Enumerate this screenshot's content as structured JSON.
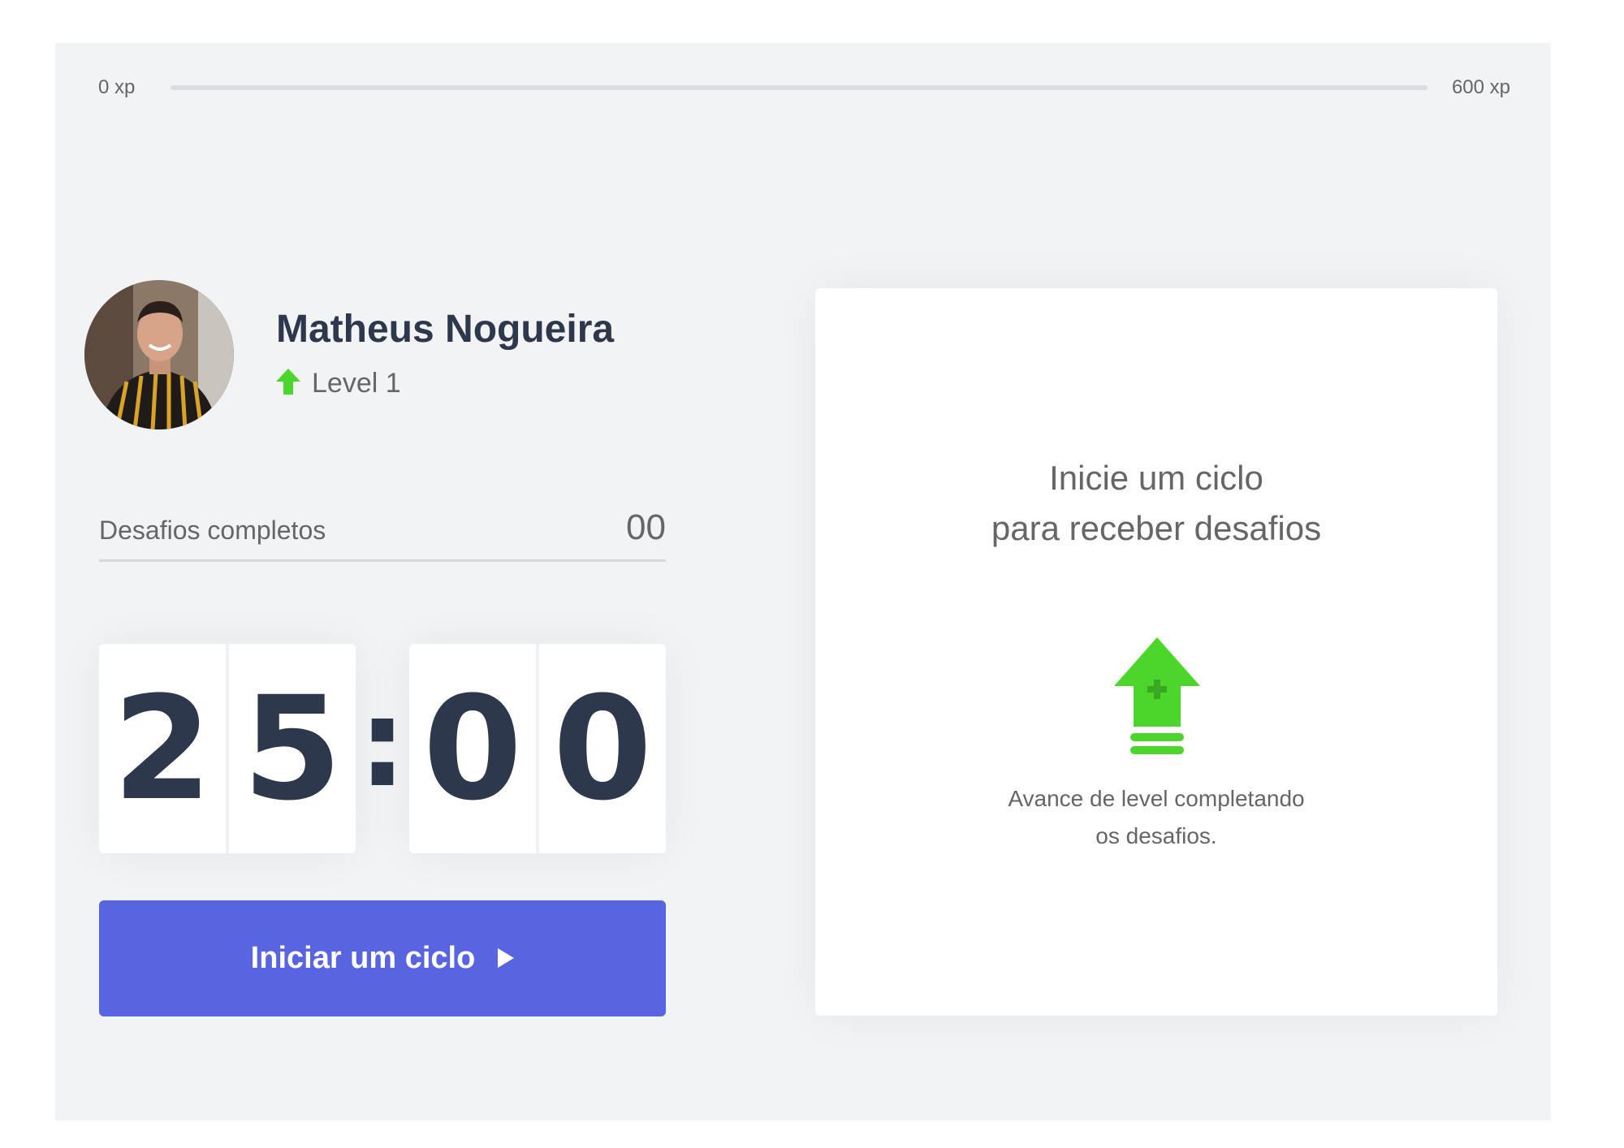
{
  "xp": {
    "min_label": "0 xp",
    "max_label": "600 xp",
    "progress_percent": 0
  },
  "profile": {
    "name": "Matheus Nogueira",
    "level_label": "Level 1",
    "avatar_icon": "user-photo"
  },
  "challenges": {
    "label": "Desafios completos",
    "count": "00"
  },
  "countdown": {
    "minute_left": "2",
    "minute_right": "5",
    "separator": ":",
    "second_left": "0",
    "second_right": "0"
  },
  "start_button": {
    "label": "Iniciar um ciclo",
    "icon": "play-icon"
  },
  "challenge_card": {
    "title_line1": "Inicie um ciclo",
    "title_line2": "para receber desafios",
    "icon": "level-up-icon",
    "description_line1": "Avance de level completando",
    "description_line2": "os desafios."
  },
  "colors": {
    "background": "#f2f3f5",
    "title": "#2e384d",
    "text": "#666666",
    "green": "#4cd62b",
    "blue": "#5965e0",
    "white": "#ffffff"
  }
}
